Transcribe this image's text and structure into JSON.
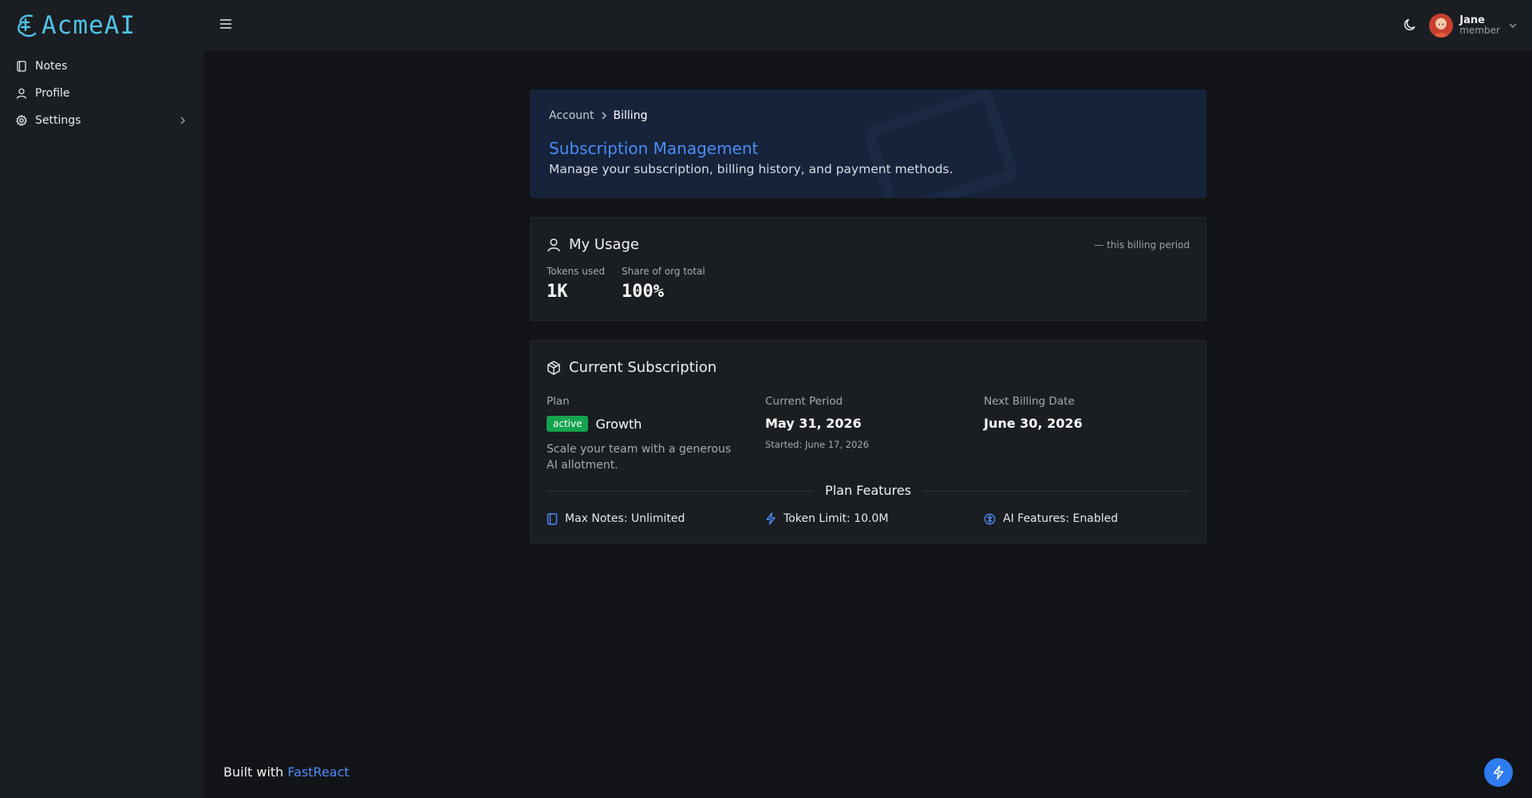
{
  "app": {
    "logo_text": "AcmeAI"
  },
  "sidebar": {
    "items": [
      {
        "label": "Notes",
        "icon": "notebook-icon"
      },
      {
        "label": "Profile",
        "icon": "user-icon"
      },
      {
        "label": "Settings",
        "icon": "gear-icon",
        "has_submenu": true
      }
    ]
  },
  "topbar": {
    "user": {
      "name": "Jane",
      "role": "member"
    }
  },
  "hero": {
    "breadcrumb": [
      "Account",
      "Billing"
    ],
    "title": "Subscription Management",
    "subtitle": "Manage your subscription, billing history, and payment methods."
  },
  "usage": {
    "title": "My Usage",
    "period_note": "— this billing period",
    "stats": [
      {
        "label": "Tokens used",
        "value": "1K"
      },
      {
        "label": "Share of org total",
        "value": "100%"
      }
    ]
  },
  "subscription": {
    "title": "Current Subscription",
    "plan_label": "Plan",
    "status_badge": "active",
    "plan_name": "Growth",
    "plan_description": "Scale your team with a generous AI allotment.",
    "current_period_label": "Current Period",
    "current_period_value": "May 31, 2026",
    "started": "Started: June 17, 2026",
    "next_billing_label": "Next Billing Date",
    "next_billing_value": "June 30, 2026",
    "features_title": "Plan Features",
    "features": [
      {
        "label": "Max Notes: Unlimited",
        "icon": "notebook-icon"
      },
      {
        "label": "Token Limit: 10.0M",
        "icon": "lightning-icon"
      },
      {
        "label": "AI Features: Enabled",
        "icon": "brain-icon"
      }
    ]
  },
  "footer": {
    "prefix": "Built with",
    "link": "FastReact"
  },
  "colors": {
    "accent": "#4b8df8",
    "logo": "#4fc3e8",
    "status_active": "#14a44d",
    "background": "#121417",
    "surface": "#1a1d21"
  }
}
